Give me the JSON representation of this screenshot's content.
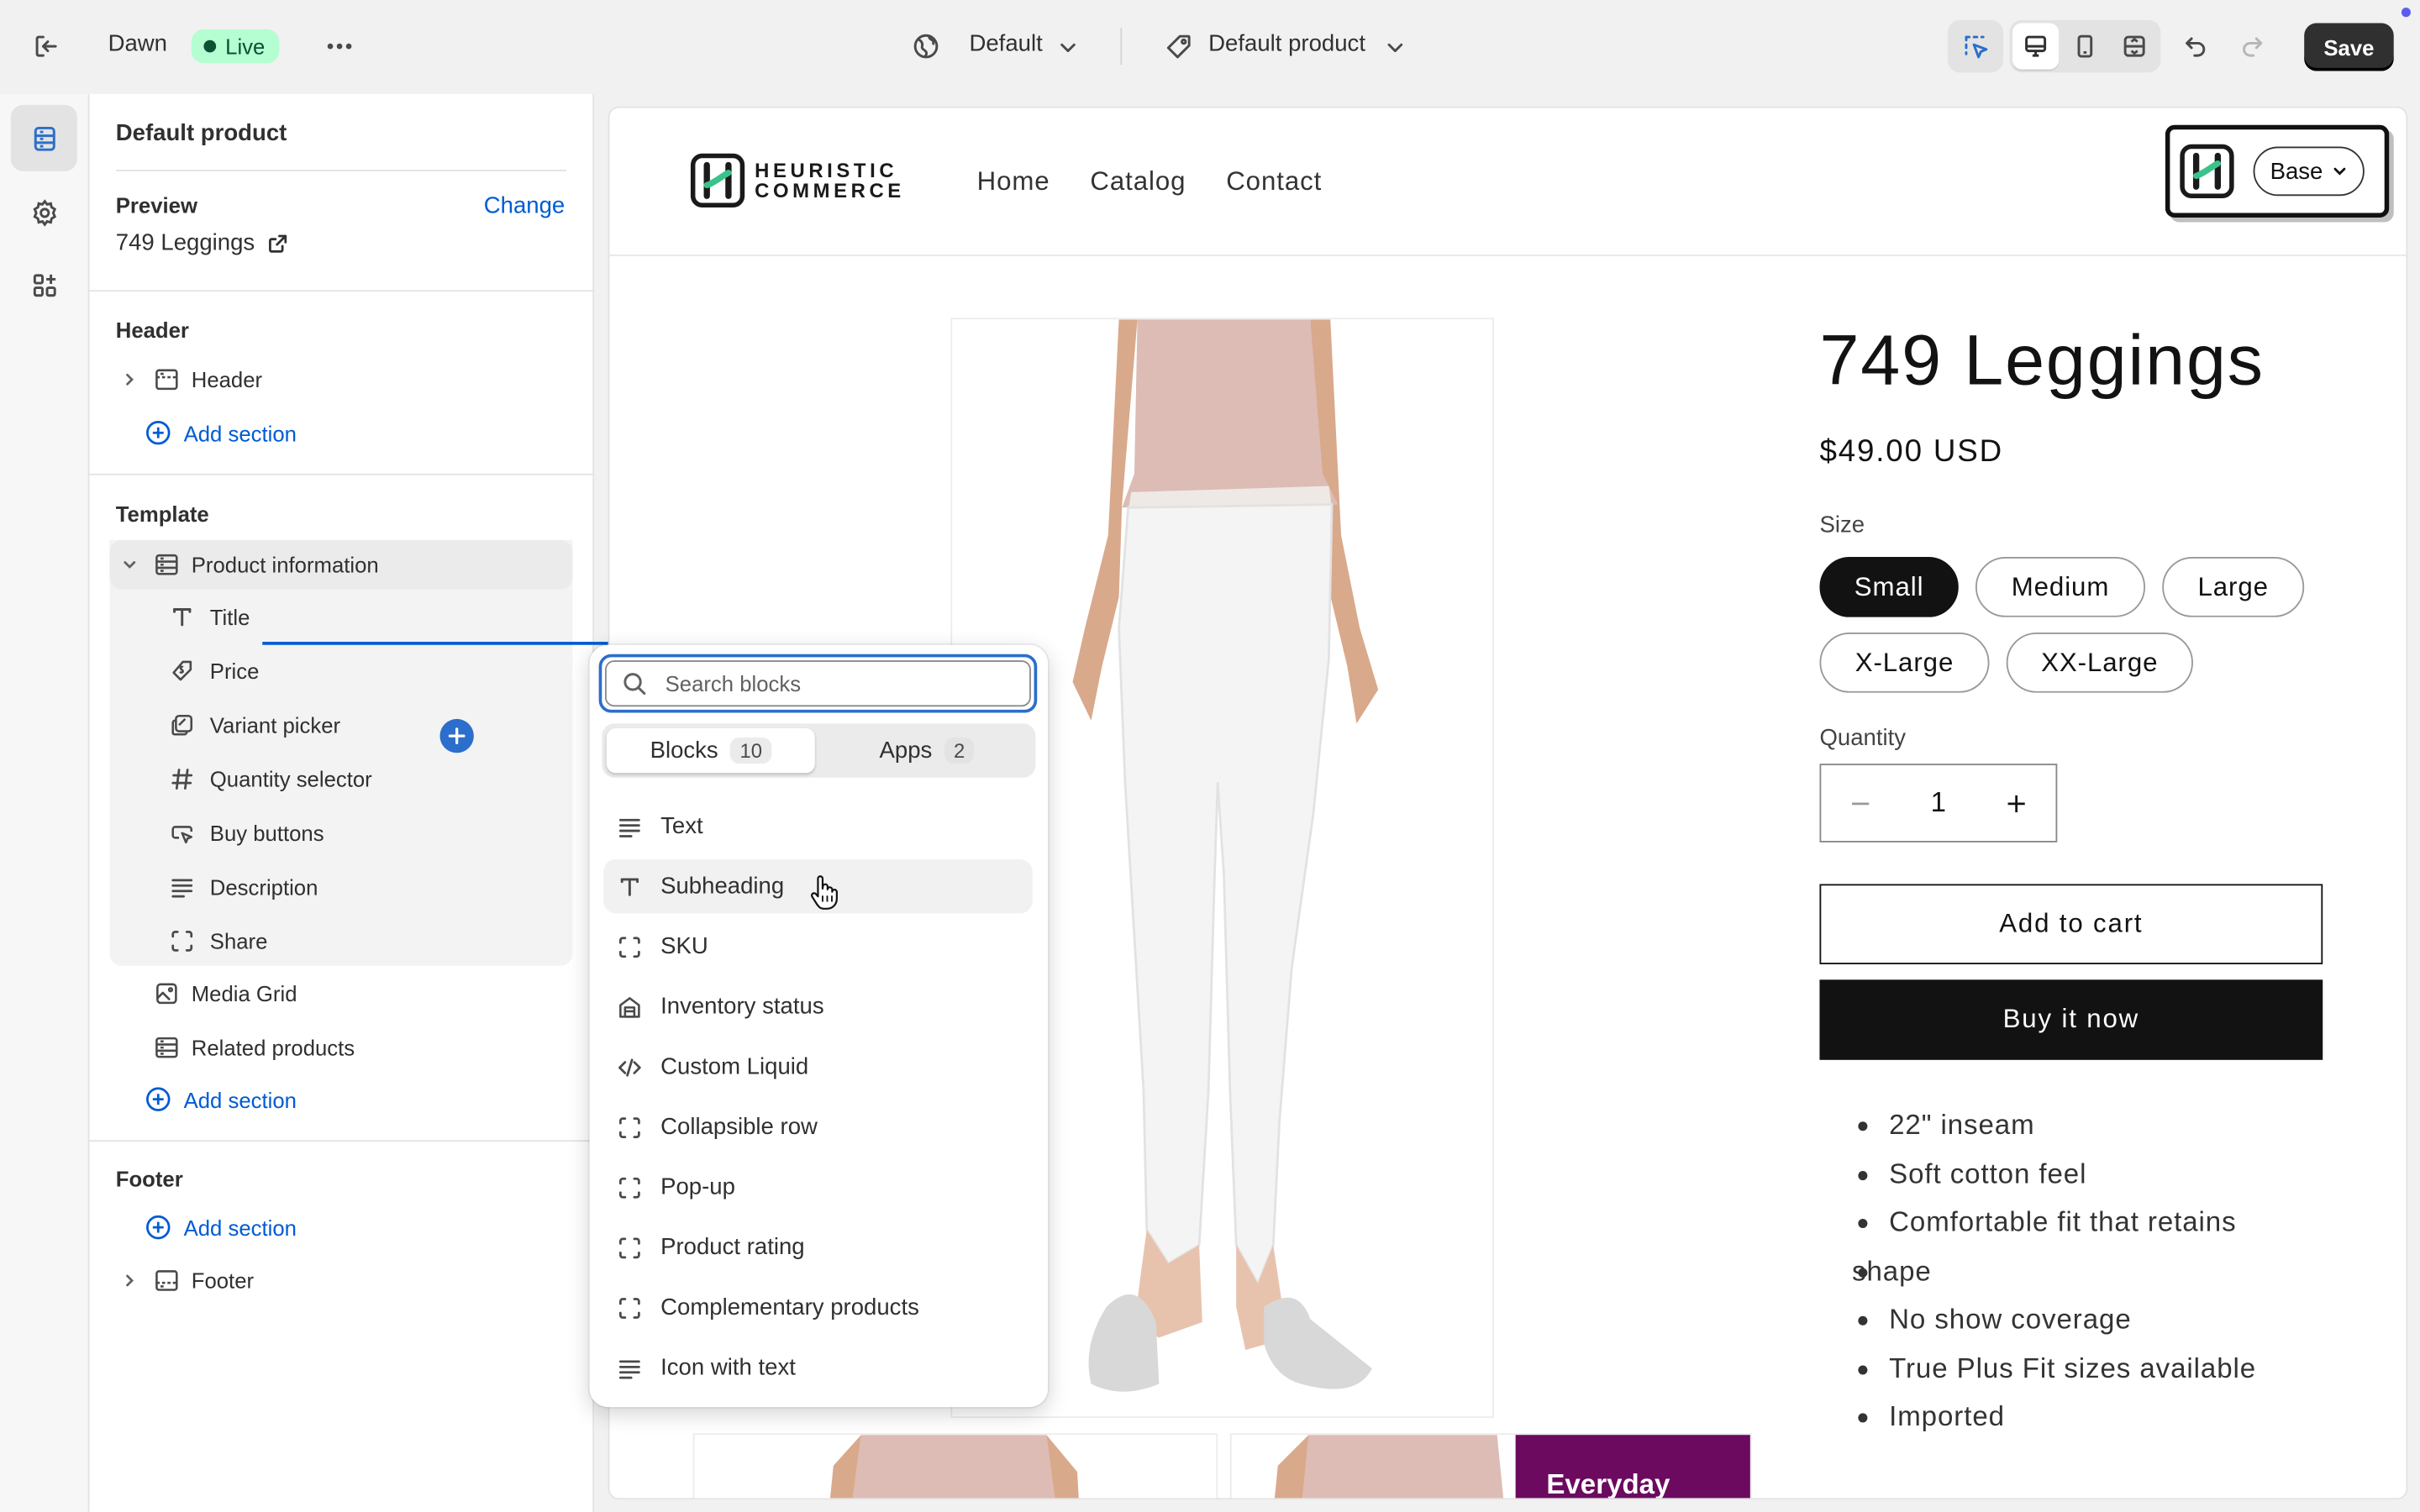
{
  "topbar": {
    "theme_name": "Dawn",
    "live_badge": "Live",
    "language": "Default",
    "template": "Default product",
    "save_label": "Save"
  },
  "sidebar": {
    "title": "Default product",
    "preview_label": "Preview",
    "change_label": "Change",
    "preview_product": "749 Leggings",
    "header_group": "Header",
    "header_item": "Header",
    "template_group": "Template",
    "product_information": "Product information",
    "blocks": [
      "Title",
      "Price",
      "Variant picker",
      "Quantity selector",
      "Buy buttons",
      "Description",
      "Share"
    ],
    "media_grid": "Media Grid",
    "related_products": "Related products",
    "add_section": "Add section",
    "footer_group": "Footer",
    "footer_item": "Footer"
  },
  "popover": {
    "search_placeholder": "Search blocks",
    "tab_blocks": "Blocks",
    "tab_blocks_count": "10",
    "tab_apps": "Apps",
    "tab_apps_count": "2",
    "items": [
      "Text",
      "Subheading",
      "SKU",
      "Inventory status",
      "Custom Liquid",
      "Collapsible row",
      "Pop-up",
      "Product rating",
      "Complementary products",
      "Icon with text"
    ]
  },
  "store": {
    "logo_line1": "HEURISTIC",
    "logo_line2": "COMMERCE",
    "nav": [
      "Home",
      "Catalog",
      "Contact"
    ],
    "widget_select": "Base",
    "product_title": "749 Leggings",
    "price": "$49.00 USD",
    "size_label": "Size",
    "sizes": [
      "Small",
      "Medium",
      "Large",
      "X-Large",
      "XX-Large"
    ],
    "selected_size": "Small",
    "quantity_label": "Quantity",
    "quantity_value": "1",
    "add_to_cart": "Add to cart",
    "buy_now": "Buy it now",
    "description": [
      "22\" inseam",
      "Soft cotton feel",
      "Comfortable fit that retains",
      "shape",
      "No show coverage",
      "True Plus Fit sizes available",
      "Imported"
    ],
    "thumbnail_banner": "Everyday"
  },
  "colors": {
    "accent": "#005bd3",
    "live_badge_bg": "#b4fed2",
    "live_badge_text": "#0c5132",
    "save_bg": "#303030",
    "banner_purple": "#6b0a5f"
  }
}
